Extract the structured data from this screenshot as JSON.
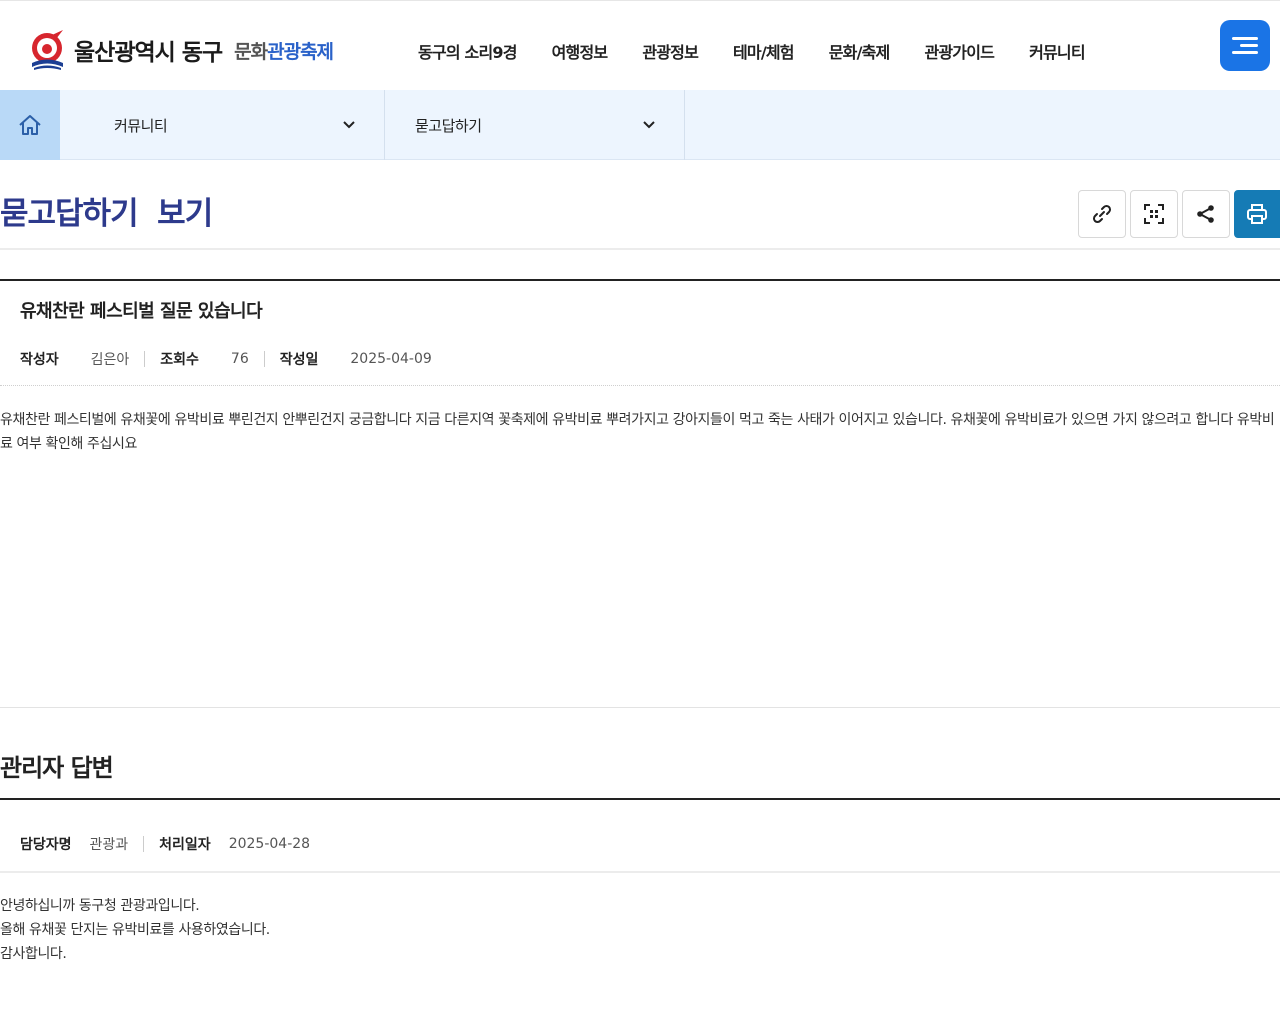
{
  "header": {
    "logo_title": "울산광역시 동구",
    "logo_sub_gray": "문화",
    "logo_sub_blue": "관광축제",
    "nav": [
      "동구의 소리9경",
      "여행정보",
      "관광정보",
      "테마/체험",
      "문화/축제",
      "관광가이드",
      "커뮤니티"
    ],
    "accent_color": "#1a74e6"
  },
  "location": {
    "depth1": "커뮤니티",
    "depth2": "묻고답하기"
  },
  "page": {
    "title": "묻고답하기  보기",
    "title_color": "#2d3a8c"
  },
  "utility_icons": [
    "link-icon",
    "qr-code-icon",
    "share-icon",
    "print-icon"
  ],
  "post": {
    "title": "유채찬란 페스티벌 질문 있습니다",
    "author_label": "작성자",
    "author": "김은아",
    "views_label": "조회수",
    "views": "76",
    "date_label": "작성일",
    "date": "2025-04-09",
    "body": "유채찬란 페스티벌에 유채꽃에 유박비료 뿌린건지 안뿌린건지 궁금합니다 지금 다른지역 꽃축제에 유박비료 뿌려가지고 강아지들이 먹고 죽는 사태가 이어지고 있습니다. 유채꽃에 유박비료가 있으면 가지 않으려고 합니다 유박비료 여부 확인해 주십시요"
  },
  "answer": {
    "section_title": "관리자 답변",
    "manager_label": "담당자명",
    "manager": "관광과",
    "processed_label": "처리일자",
    "processed": "2025-04-28",
    "lines": [
      "안녕하십니까 동구청 관광과입니다.",
      "올해 유채꽃 단지는 유박비료를 사용하였습니다.",
      "감사합니다."
    ]
  }
}
